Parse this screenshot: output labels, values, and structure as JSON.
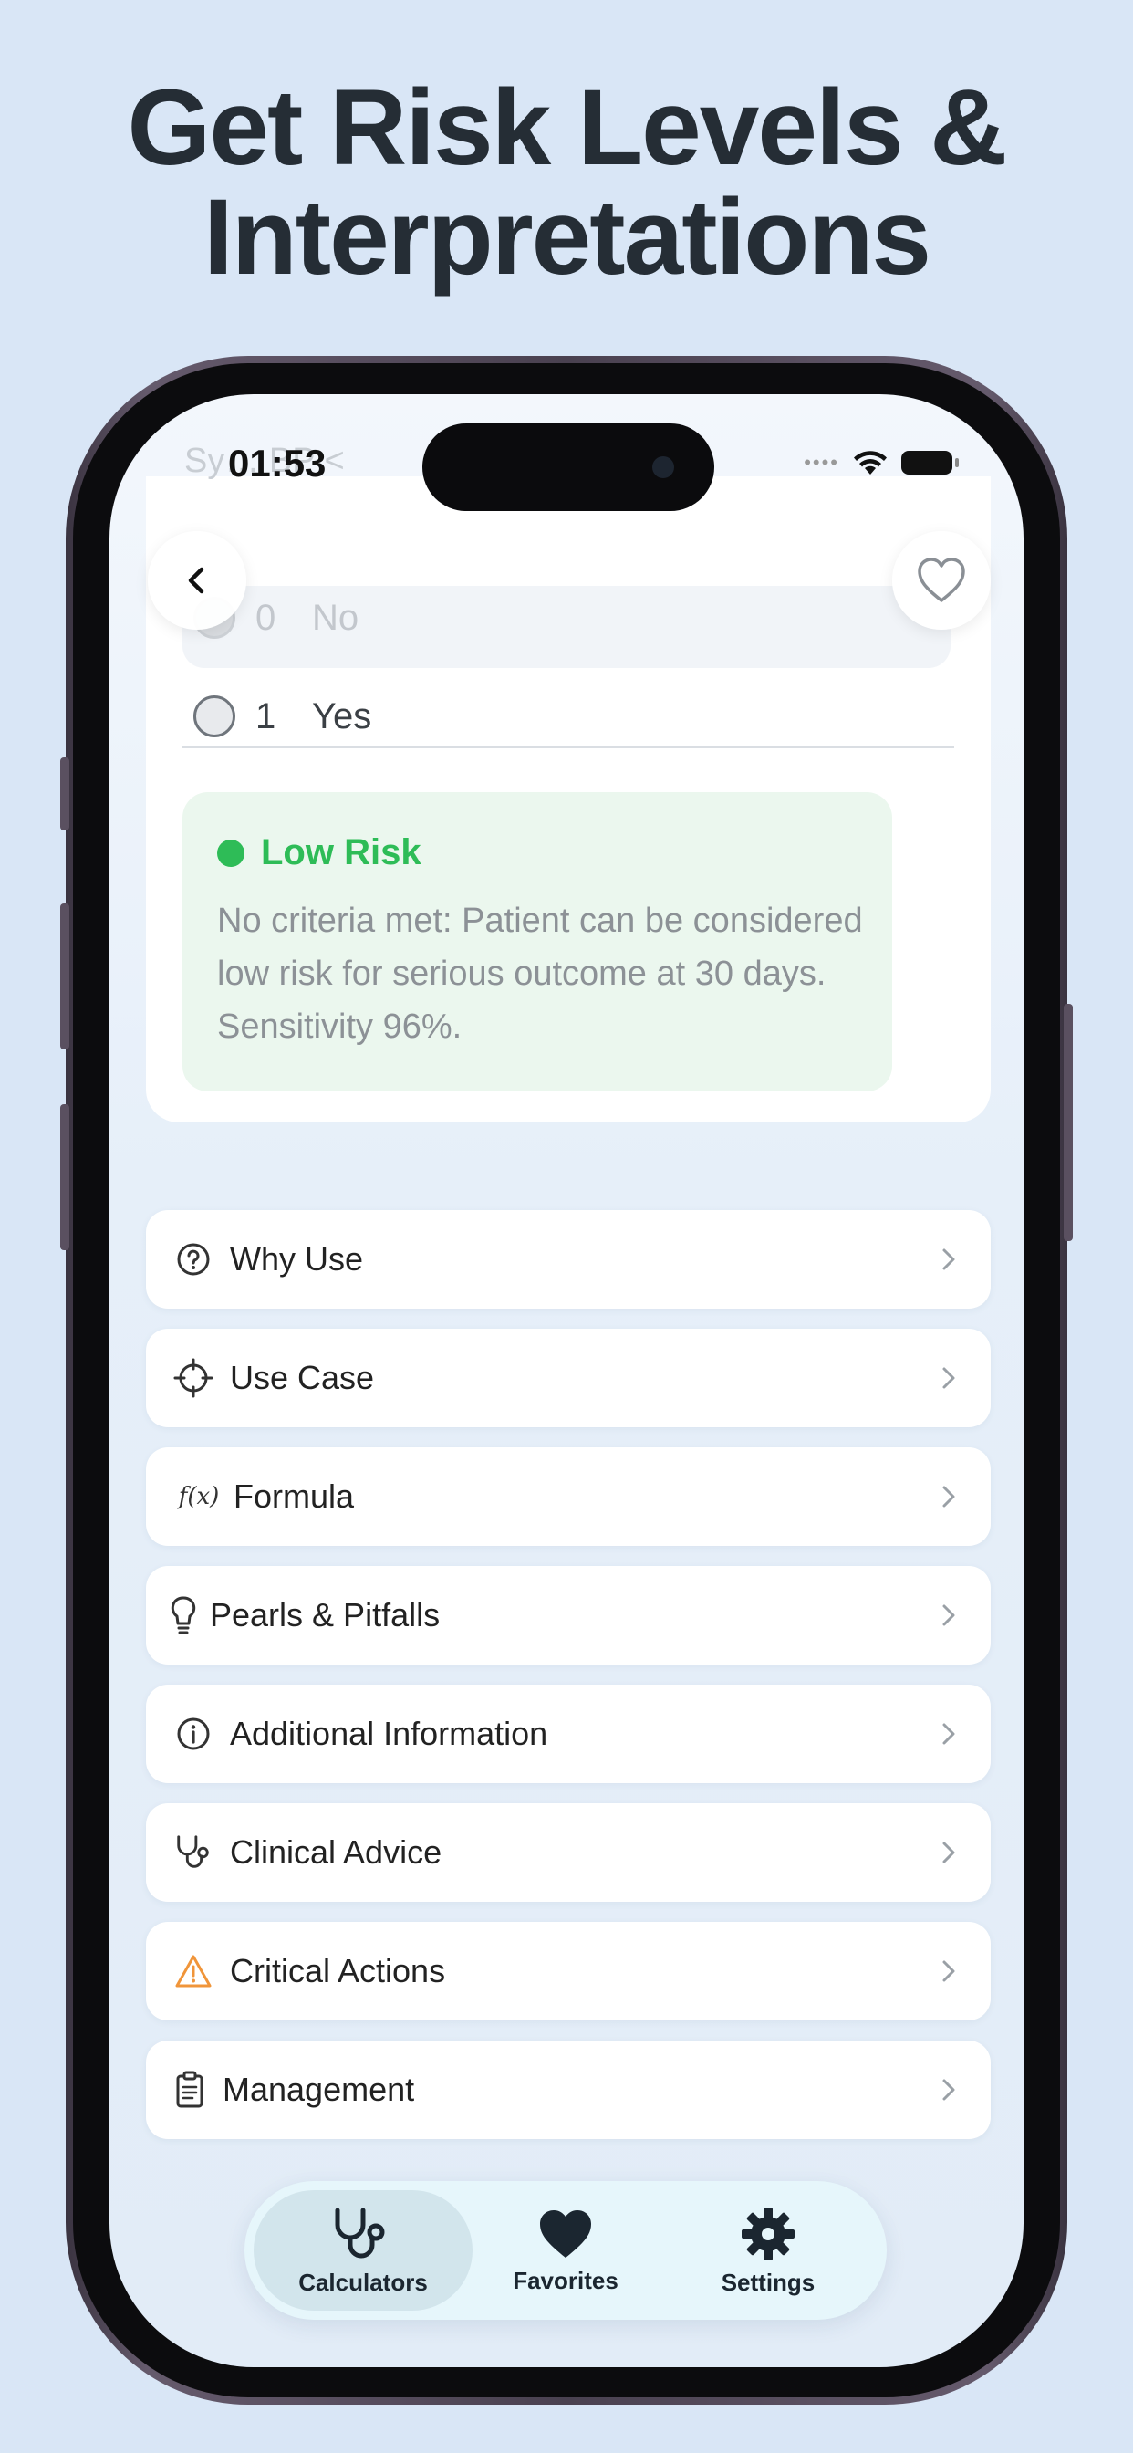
{
  "headline": {
    "line1": "Get Risk Levels &",
    "line2": "Interpretations"
  },
  "status_bar": {
    "time": "01:53",
    "ghost_text": "Sy… BP <"
  },
  "options": [
    {
      "value": "0",
      "label": "No",
      "selected": false
    },
    {
      "value": "1",
      "label": "Yes",
      "selected": false
    }
  ],
  "risk": {
    "title": "Low Risk",
    "description": "No criteria met: Patient can be considered low risk for serious outcome at 30 days. Sensitivity 96%.",
    "color": "#2ebc57"
  },
  "menu": [
    {
      "label": "Why Use",
      "icon": "question-circle-icon"
    },
    {
      "label": "Use Case",
      "icon": "crosshair-icon"
    },
    {
      "label": "Formula",
      "icon": "function-icon",
      "icon_text": "f(x)"
    },
    {
      "label": "Pearls & Pitfalls",
      "icon": "lightbulb-icon"
    },
    {
      "label": "Additional Information",
      "icon": "info-circle-icon"
    },
    {
      "label": "Clinical Advice",
      "icon": "stethoscope-icon"
    },
    {
      "label": "Critical Actions",
      "icon": "warning-triangle-icon",
      "icon_color": "#f0953a"
    },
    {
      "label": "Management",
      "icon": "clipboard-icon"
    }
  ],
  "tabs": [
    {
      "label": "Calculators",
      "icon": "stethoscope-icon",
      "active": true
    },
    {
      "label": "Favorites",
      "icon": "heart-icon",
      "active": false
    },
    {
      "label": "Settings",
      "icon": "gear-icon",
      "active": false
    }
  ]
}
